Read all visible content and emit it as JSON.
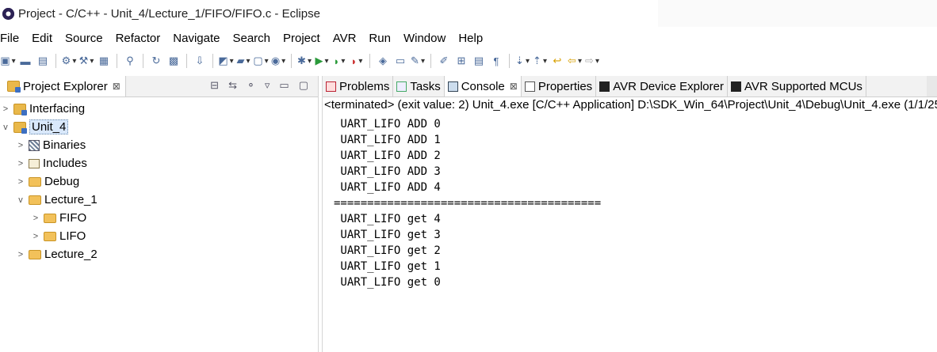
{
  "window": {
    "title": "Project - C/C++ - Unit_4/Lecture_1/FIFO/FIFO.c - Eclipse"
  },
  "menu": [
    "File",
    "Edit",
    "Source",
    "Refactor",
    "Navigate",
    "Search",
    "Project",
    "AVR",
    "Run",
    "Window",
    "Help"
  ],
  "explorer": {
    "tab_label": "Project Explorer",
    "close_glyph": "⊠",
    "tree": [
      {
        "label": "Interfacing",
        "twisty": ">",
        "icon": "project-icon",
        "level": 0
      },
      {
        "label": "Unit_4",
        "twisty": "v",
        "icon": "project-icon",
        "level": 0,
        "selected": true
      },
      {
        "label": "Binaries",
        "twisty": ">",
        "icon": "binaries-icon",
        "level": 1
      },
      {
        "label": "Includes",
        "twisty": ">",
        "icon": "includes-icon",
        "level": 1
      },
      {
        "label": "Debug",
        "twisty": ">",
        "icon": "folder-icon",
        "level": 1
      },
      {
        "label": "Lecture_1",
        "twisty": "v",
        "icon": "folder-icon",
        "level": 1
      },
      {
        "label": "FIFO",
        "twisty": ">",
        "icon": "folder-icon",
        "level": 2
      },
      {
        "label": "LIFO",
        "twisty": ">",
        "icon": "folder-icon",
        "level": 2
      },
      {
        "label": "Lecture_2",
        "twisty": ">",
        "icon": "folder-icon",
        "level": 1
      }
    ]
  },
  "views": {
    "tabs": [
      {
        "label": "Problems",
        "icon": "problems-icon"
      },
      {
        "label": "Tasks",
        "icon": "tasks-icon"
      },
      {
        "label": "Console",
        "icon": "console-icon",
        "active": true
      },
      {
        "label": "Properties",
        "icon": "properties-icon"
      },
      {
        "label": "AVR Device Explorer",
        "icon": "chip-icon"
      },
      {
        "label": "AVR Supported MCUs",
        "icon": "chip-icon"
      }
    ],
    "close_glyph": "⊠"
  },
  "console": {
    "header": "<terminated> (exit value: 2) Unit_4.exe [C/C++ Application] D:\\SDK_Win_64\\Project\\Unit_4\\Debug\\Unit_4.exe (1/1/25",
    "lines": [
      " UART_LIFO ADD 0",
      " UART_LIFO ADD 1",
      " UART_LIFO ADD 2",
      " UART_LIFO ADD 3",
      " UART_LIFO ADD 4",
      "========================================",
      " UART_LIFO get 4",
      " UART_LIFO get 3",
      " UART_LIFO get 2",
      " UART_LIFO get 1",
      " UART_LIFO get 0"
    ]
  }
}
